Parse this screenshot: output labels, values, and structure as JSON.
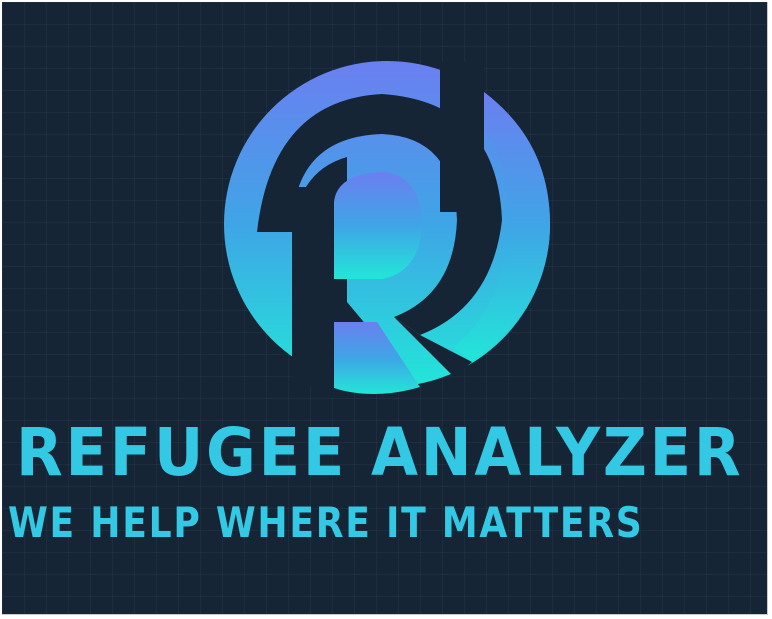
{
  "brand": {
    "logo_icon": "rd-circle-logo-icon",
    "title": "REFUGEE ANALYZER",
    "tagline": "WE HELP WHERE IT MATTERS"
  },
  "colors": {
    "background": "#162536",
    "text": "#33c8e3",
    "gradient_top": "#6b7ff0",
    "gradient_mid": "#3fa5e6",
    "gradient_bottom": "#22e6d8"
  }
}
